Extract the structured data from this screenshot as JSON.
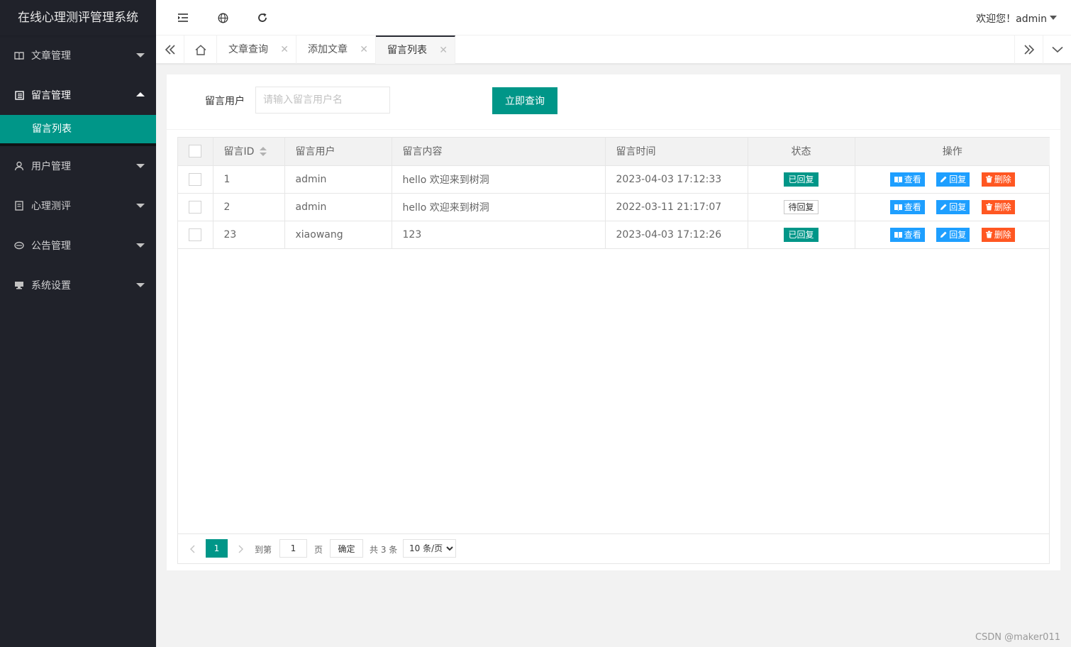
{
  "app": {
    "title": "在线心理测评管理系统"
  },
  "sidebar": {
    "items": [
      {
        "label": "文章管理",
        "icon": "book-icon",
        "open": false
      },
      {
        "label": "留言管理",
        "icon": "list-icon",
        "open": true,
        "children": [
          {
            "label": "留言列表",
            "active": true
          }
        ]
      },
      {
        "label": "用户管理",
        "icon": "user-icon",
        "open": false
      },
      {
        "label": "心理测评",
        "icon": "form-icon",
        "open": false
      },
      {
        "label": "公告管理",
        "icon": "release-icon",
        "open": false
      },
      {
        "label": "系统设置",
        "icon": "settings-icon",
        "open": false
      }
    ]
  },
  "header": {
    "welcome": "欢迎您！admin",
    "icons": [
      "menu-fold-icon",
      "globe-icon",
      "refresh-icon"
    ]
  },
  "tabs": [
    {
      "label": "文章查询",
      "active": false
    },
    {
      "label": "添加文章",
      "active": false
    },
    {
      "label": "留言列表",
      "active": true
    }
  ],
  "filter": {
    "label": "留言用户",
    "placeholder": "请输入留言用户名",
    "value": "",
    "search_button": "立即查询"
  },
  "table": {
    "columns": [
      "留言ID",
      "留言用户",
      "留言内容",
      "留言时间",
      "状态",
      "操作"
    ],
    "rows": [
      {
        "id": "1",
        "user": "admin",
        "content": "hello 欢迎来到树洞",
        "time": "2023-04-03 17:12:33",
        "status": "已回复",
        "status_type": "replied"
      },
      {
        "id": "2",
        "user": "admin",
        "content": "hello 欢迎来到树洞",
        "time": "2022-03-11 21:17:07",
        "status": "待回复",
        "status_type": "pending"
      },
      {
        "id": "23",
        "user": "xiaowang",
        "content": "123",
        "time": "2023-04-03 17:12:26",
        "status": "已回复",
        "status_type": "replied"
      }
    ],
    "actions": {
      "view": "查看",
      "reply": "回复",
      "delete": "删除"
    }
  },
  "pagination": {
    "current": "1",
    "goto_label": "到第",
    "goto_value": "1",
    "page_unit": "页",
    "confirm": "确定",
    "total": "共 3 条",
    "page_size": "10 条/页"
  },
  "watermark": "CSDN @maker011",
  "colors": {
    "sidebar_bg": "#20222a",
    "accent": "#009688",
    "info": "#1e9fff",
    "danger": "#ff5722"
  }
}
